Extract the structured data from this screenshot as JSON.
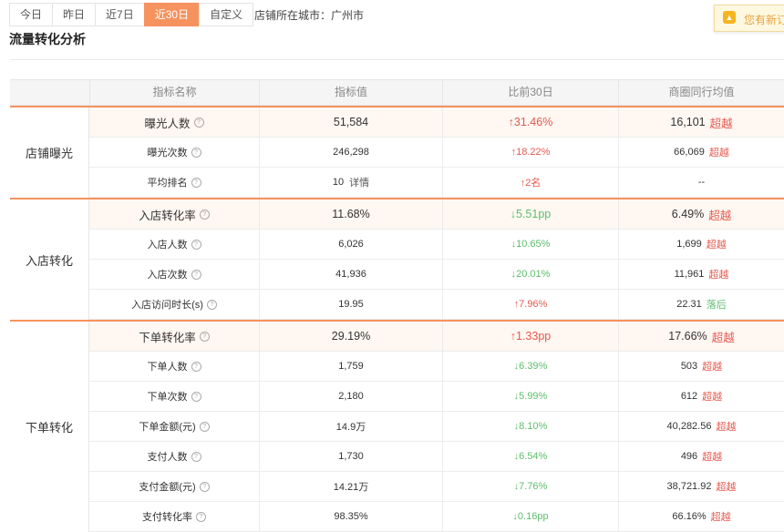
{
  "tabs": [
    {
      "label": "今日",
      "active": false
    },
    {
      "label": "昨日",
      "active": false
    },
    {
      "label": "近7日",
      "active": false
    },
    {
      "label": "近30日",
      "active": true
    },
    {
      "label": "自定义",
      "active": false
    }
  ],
  "city_label": "店铺所在城市：广州市",
  "notice_text": "您有新订",
  "title": "流量转化分析",
  "headers": [
    "",
    "指标名称",
    "指标值",
    "比前30日",
    "商圈同行均值"
  ],
  "groups": [
    {
      "label": "店铺曝光",
      "rows": [
        {
          "name": "曝光人数",
          "value": "51,584",
          "change": "↑31.46%",
          "dir": "up",
          "peer": "16,101",
          "compare": "超越",
          "main": true
        },
        {
          "name": "曝光次数",
          "value": "246,298",
          "change": "↑18.22%",
          "dir": "up",
          "peer": "66,069",
          "compare": "超越",
          "main": false
        },
        {
          "name": "平均排名",
          "value": "10",
          "detail": "详情",
          "change": "↑2名",
          "dir": "up",
          "peer": "--",
          "compare": "",
          "main": false
        }
      ]
    },
    {
      "label": "入店转化",
      "rows": [
        {
          "name": "入店转化率",
          "value": "11.68%",
          "change": "↓5.51pp",
          "dir": "down",
          "peer": "6.49%",
          "compare": "超越",
          "main": true
        },
        {
          "name": "入店人数",
          "value": "6,026",
          "change": "↓10.65%",
          "dir": "down",
          "peer": "1,699",
          "compare": "超越",
          "main": false
        },
        {
          "name": "入店次数",
          "value": "41,936",
          "change": "↓20.01%",
          "dir": "down",
          "peer": "11,961",
          "compare": "超越",
          "main": false
        },
        {
          "name": "入店访问时长(s)",
          "value": "19.95",
          "change": "↑7.96%",
          "dir": "up",
          "peer": "22.31",
          "compare": "落后",
          "compare_dir": "worse",
          "main": false
        }
      ]
    },
    {
      "label": "下单转化",
      "rows": [
        {
          "name": "下单转化率",
          "value": "29.19%",
          "change": "↑1.33pp",
          "dir": "up",
          "peer": "17.66%",
          "compare": "超越",
          "main": true
        },
        {
          "name": "下单人数",
          "value": "1,759",
          "change": "↓6.39%",
          "dir": "down",
          "peer": "503",
          "compare": "超越",
          "main": false
        },
        {
          "name": "下单次数",
          "value": "2,180",
          "change": "↓5.99%",
          "dir": "down",
          "peer": "612",
          "compare": "超越",
          "main": false
        },
        {
          "name": "下单金额(元)",
          "value": "14.9万",
          "change": "↓8.10%",
          "dir": "down",
          "peer": "40,282.56",
          "compare": "超越",
          "main": false
        },
        {
          "name": "支付人数",
          "value": "1,730",
          "change": "↓6.54%",
          "dir": "down",
          "peer": "496",
          "compare": "超越",
          "main": false
        },
        {
          "name": "支付金额(元)",
          "value": "14.21万",
          "change": "↓7.76%",
          "dir": "down",
          "peer": "38,721.92",
          "compare": "超越",
          "main": false
        },
        {
          "name": "支付转化率",
          "value": "98.35%",
          "change": "↓0.16pp",
          "dir": "down",
          "peer": "66.16%",
          "compare": "超越",
          "main": false
        }
      ]
    }
  ],
  "colors": {
    "accent": "#f6925e",
    "up": "#e55a4f",
    "down": "#5cbf6b"
  }
}
